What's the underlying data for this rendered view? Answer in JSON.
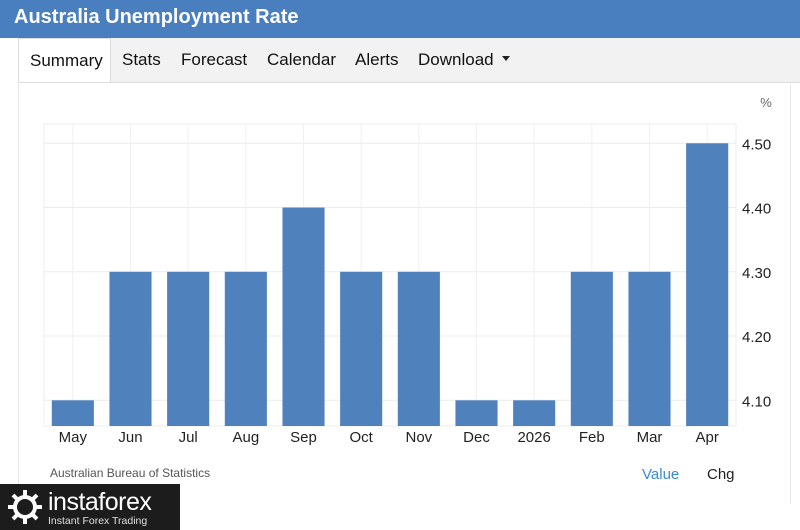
{
  "header": {
    "title": "Australia Unemployment Rate"
  },
  "tabs": [
    {
      "label": "Summary"
    },
    {
      "label": "Stats"
    },
    {
      "label": "Forecast"
    },
    {
      "label": "Calendar"
    },
    {
      "label": "Alerts"
    },
    {
      "label": "Download"
    }
  ],
  "chart_data": {
    "type": "bar",
    "categories": [
      "May",
      "Jun",
      "Jul",
      "Aug",
      "Sep",
      "Oct",
      "Nov",
      "Dec",
      "2026",
      "Feb",
      "Mar",
      "Apr"
    ],
    "values": [
      4.1,
      4.3,
      4.3,
      4.3,
      4.4,
      4.3,
      4.3,
      4.1,
      4.1,
      4.3,
      4.3,
      4.5
    ],
    "yticks": [
      "4.10",
      "4.20",
      "4.30",
      "4.40",
      "4.50"
    ],
    "yunit": "%",
    "ylim": [
      4.06,
      4.53
    ],
    "grid": true,
    "bar_color": "#4f81bd"
  },
  "footer": {
    "source": "Australian Bureau of Statistics",
    "value_label": "Value",
    "chg_label": "Chg"
  },
  "watermark": {
    "brand": "instaforex",
    "tagline": "Instant Forex Trading"
  }
}
